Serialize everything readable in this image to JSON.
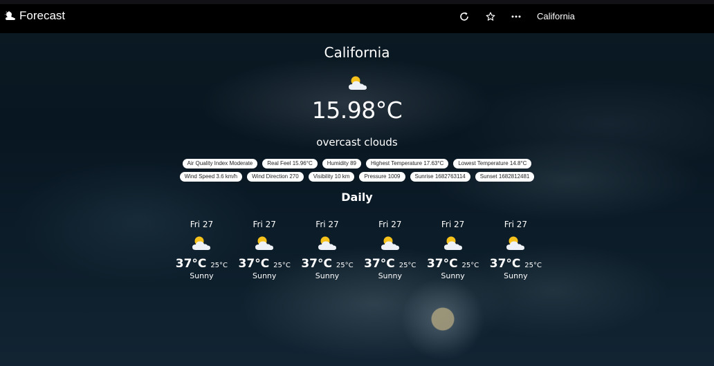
{
  "app": {
    "title": "Forecast",
    "location": "California"
  },
  "icons": {
    "brand": "cloud-sun-icon",
    "refresh": "refresh-icon",
    "favorite": "star-icon",
    "more": "more-icon",
    "weather": "sun-behind-cloud-icon"
  },
  "current": {
    "city": "California",
    "temperature": "15.98°C",
    "description": "overcast clouds",
    "details_row1": [
      "Air Quality Index Moderate",
      "Real Feel 15.96°C",
      "Humidity 89",
      "Highest Temperature 17.63°C",
      "Lowest Temperature 14.8°C"
    ],
    "details_row2": [
      "Wind Speed 3.6 km/h",
      "Wind Direction 270",
      "Visibility 10 km",
      "Pressure 1009",
      "Sunrise 1682763114",
      "Sunset 1682812481"
    ]
  },
  "daily": {
    "title": "Daily",
    "days": [
      {
        "date": "Fri 27",
        "high": "37°C",
        "low": "25°C",
        "condition": "Sunny"
      },
      {
        "date": "Fri 27",
        "high": "37°C",
        "low": "25°C",
        "condition": "Sunny"
      },
      {
        "date": "Fri 27",
        "high": "37°C",
        "low": "25°C",
        "condition": "Sunny"
      },
      {
        "date": "Fri 27",
        "high": "37°C",
        "low": "25°C",
        "condition": "Sunny"
      },
      {
        "date": "Fri 27",
        "high": "37°C",
        "low": "25°C",
        "condition": "Sunny"
      },
      {
        "date": "Fri 27",
        "high": "37°C",
        "low": "25°C",
        "condition": "Sunny"
      }
    ]
  }
}
